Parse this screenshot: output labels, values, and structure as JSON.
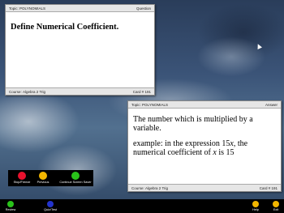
{
  "question_card": {
    "topic_label": "Topic:",
    "topic": "POLYNOMIALS",
    "side": "Question",
    "text": "Define Numerical Coefficient.",
    "course_label": "Course:",
    "course": "Algebra 2 Trig",
    "card_no": "Card # 191"
  },
  "answer_card": {
    "topic_label": "Topic:",
    "topic": "POLYNOMIALS",
    "side": "Answer",
    "line1": "The number which is multiplied by a variable.",
    "line2_prefix": "example: in the expression 15",
    "line2_var": "x",
    "line2_mid": ", the numerical coefficient of",
    "line2_var2": "x",
    "line2_suffix": "is 15",
    "course_label": "Course:",
    "course": "Algebra 2 Trig",
    "card_no": "Card # 191"
  },
  "controls": {
    "stop": {
      "label": "Stop/Freeze",
      "color": "#e8112d"
    },
    "previous": {
      "label": "Previous",
      "color": "#f2b600"
    },
    "continue": {
      "label": "Continue Screen Saver",
      "color": "#29c21a"
    }
  },
  "bottom_bar": {
    "review": {
      "label": "Review",
      "color": "#29c21a"
    },
    "quiz": {
      "label": "Quiz/Test",
      "color": "#2233cc"
    },
    "help": {
      "label": "Help",
      "color": "#f2b600"
    },
    "exit": {
      "label": "Exit",
      "color": "#f2b600"
    }
  }
}
